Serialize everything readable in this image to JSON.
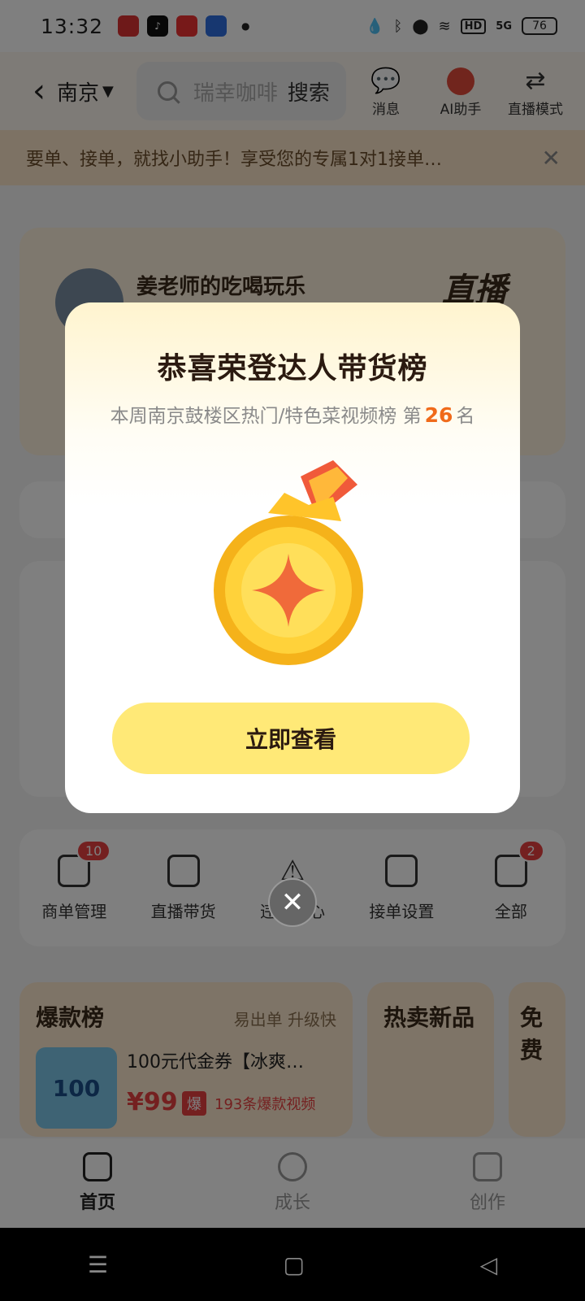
{
  "status_bar": {
    "time": "13:32",
    "battery": "76",
    "network": "5G",
    "hd": "HD"
  },
  "header": {
    "city": "南京",
    "search_placeholder": "瑞幸咖啡",
    "search_button": "搜索",
    "icons": [
      {
        "label": "消息",
        "icon": "message-icon"
      },
      {
        "label": "AI助手",
        "icon": "ai-assistant-icon"
      },
      {
        "label": "直播模式",
        "icon": "swap-icon"
      }
    ]
  },
  "banner": {
    "text": "要单、接单，就找小助手！享受您的专属1对1接单…"
  },
  "profile": {
    "name": "姜老师的吃喝玩乐",
    "side_label": "直播"
  },
  "grid": [
    {
      "label": "商单管理",
      "badge": "10"
    },
    {
      "label": "直播带货",
      "badge": ""
    },
    {
      "label": "违规中心",
      "badge": ""
    },
    {
      "label": "接单设置",
      "badge": ""
    },
    {
      "label": "全部",
      "badge": "2"
    }
  ],
  "hot_list": {
    "title": "爆款榜",
    "subtitle": "易出单 升级快",
    "item_title": "100元代金券【冰爽…",
    "price": "¥99",
    "tag": "爆",
    "videos": "193条爆款视频",
    "coupon_value": "100"
  },
  "side_cards": [
    {
      "title": "热卖新品"
    },
    {
      "title": "免费"
    }
  ],
  "bottom_nav": [
    {
      "label": "首页",
      "active": true
    },
    {
      "label": "成长",
      "active": false
    },
    {
      "label": "创作",
      "active": false
    }
  ],
  "dialog": {
    "title": "恭喜荣登达人带货榜",
    "sub_prefix": "本周南京鼓楼区热门/特色菜视频榜 第",
    "rank": "26",
    "sub_suffix": "名",
    "button": "立即查看"
  },
  "colors": {
    "accent": "#f06a1a",
    "button": "#ffe977",
    "badge": "#e94141"
  }
}
